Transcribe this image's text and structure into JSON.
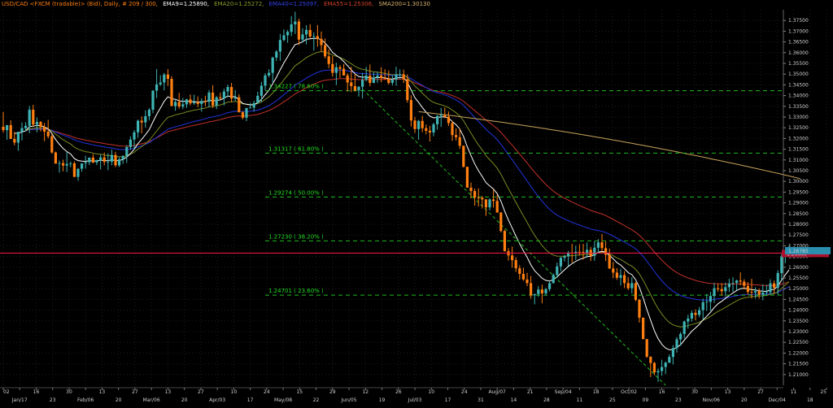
{
  "header": {
    "symbol": "USD/CAD <FXCM (tradable)> (Bid), Daily, # 209 / 300,",
    "ema9": "EMA9=1.25890,",
    "ema20": "EMA20=1.25272,",
    "ema40": "EMA40=1.25097,",
    "ema55": "EMA55=1.25306,",
    "sma200": "SMA200=1.30130"
  },
  "colors": {
    "background": "#000000",
    "bull": "#3fb3b3",
    "bear": "#ff7f11",
    "ema9": "#ffffff",
    "ema20": "#7a8a22",
    "ema40": "#2233dd",
    "ema55": "#c2312a",
    "sma200": "#c8a35c",
    "fib": "#22bb22",
    "price_line": "#ff1a4a",
    "grid": "#1e1e1e"
  },
  "chart_data": {
    "type": "candlestick",
    "y_range": [
      1.205,
      1.38
    ],
    "y_ticks": [
      "1.37500",
      "1.37000",
      "1.36500",
      "1.36000",
      "1.35500",
      "1.35000",
      "1.34500",
      "1.34000",
      "1.33500",
      "1.33000",
      "1.32500",
      "1.32000",
      "1.31500",
      "1.31000",
      "1.30500",
      "1.30000",
      "1.29500",
      "1.29000",
      "1.28500",
      "1.28000",
      "1.27500",
      "1.27000",
      "1.26500",
      "1.26000",
      "1.25500",
      "1.25000",
      "1.24500",
      "1.24000",
      "1.23500",
      "1.23000",
      "1.22500",
      "1.22000",
      "1.21500",
      "1.21000"
    ],
    "x_labels": [
      "02",
      "Jan/17",
      "16",
      "23",
      "30",
      "Feb/06",
      "13",
      "20",
      "27",
      "Mar/06",
      "13",
      "20",
      "27",
      "Apr/03",
      "10",
      "17",
      "24",
      "May/08",
      "15",
      "22",
      "29",
      "Jun/05",
      "12",
      "19",
      "26",
      "Jul/03",
      "10",
      "17",
      "24",
      "31",
      "Aug/07",
      "14",
      "21",
      "28",
      "Sep/04",
      "11",
      "18",
      "25",
      "Oct/02",
      "09",
      "16",
      "23",
      "30",
      "Nov/06",
      "13",
      "20",
      "27",
      "Dec/04",
      "11",
      "18",
      "25"
    ],
    "current_price": {
      "value": 1.2666,
      "label": "1.26660"
    },
    "last_close_label": "1.26785",
    "grid": true,
    "fib_levels": [
      {
        "value": 1.34227,
        "label": "1.34227 ( 78.60% )"
      },
      {
        "value": 1.31317,
        "label": "1.31317 ( 61.80% )"
      },
      {
        "value": 1.29274,
        "label": "1.29274 ( 50.00% )"
      },
      {
        "value": 1.2723,
        "label": "1.27230 ( 38.20% )"
      },
      {
        "value": 1.24701,
        "label": "1.24701 ( 23.60% )"
      }
    ],
    "trendline": {
      "from": {
        "bar": 96,
        "price": 1.343
      },
      "to": {
        "bar": 177,
        "price": 1.205
      }
    },
    "sma200_anchor": {
      "bar": 111,
      "price": 1.3325
    },
    "sma200_end": {
      "bar": 213,
      "price": 1.3013
    },
    "ohlc": [
      [
        1.3255,
        1.3323,
        1.3227,
        1.3239
      ],
      [
        1.3239,
        1.3263,
        1.3194,
        1.3262
      ],
      [
        1.3262,
        1.3285,
        1.3198,
        1.3198
      ],
      [
        1.3198,
        1.3231,
        1.3168,
        1.3181
      ],
      [
        1.3181,
        1.3231,
        1.3143,
        1.3231
      ],
      [
        1.3231,
        1.3275,
        1.3191,
        1.3248
      ],
      [
        1.3248,
        1.3276,
        1.3235,
        1.3259
      ],
      [
        1.3259,
        1.3352,
        1.3224,
        1.3334
      ],
      [
        1.3334,
        1.3357,
        1.3255,
        1.3265
      ],
      [
        1.3265,
        1.3298,
        1.3229,
        1.3277
      ],
      [
        1.3277,
        1.3281,
        1.3233,
        1.3254
      ],
      [
        1.3254,
        1.3272,
        1.3187,
        1.3232
      ],
      [
        1.3232,
        1.3287,
        1.32,
        1.321
      ],
      [
        1.321,
        1.3222,
        1.3129,
        1.3135
      ],
      [
        1.3135,
        1.3139,
        1.3083,
        1.3083
      ],
      [
        1.3083,
        1.3097,
        1.3041,
        1.3085
      ],
      [
        1.3085,
        1.3101,
        1.3047,
        1.3074
      ],
      [
        1.3074,
        1.3137,
        1.3044,
        1.3081
      ],
      [
        1.3081,
        1.3093,
        1.3066,
        1.3084
      ],
      [
        1.3084,
        1.3093,
        1.3021,
        1.3021
      ],
      [
        1.3021,
        1.3061,
        1.3003,
        1.3059
      ],
      [
        1.3059,
        1.3084,
        1.3045,
        1.3084
      ],
      [
        1.3084,
        1.312,
        1.306,
        1.3089
      ],
      [
        1.3089,
        1.3111,
        1.3076,
        1.3111
      ],
      [
        1.3111,
        1.3127,
        1.3085,
        1.3088
      ],
      [
        1.3088,
        1.3102,
        1.3076,
        1.3098
      ],
      [
        1.3098,
        1.3125,
        1.3056,
        1.3112
      ],
      [
        1.3112,
        1.3135,
        1.3075,
        1.3091
      ],
      [
        1.3091,
        1.3131,
        1.3053,
        1.3092
      ],
      [
        1.3092,
        1.3148,
        1.3075,
        1.3123
      ],
      [
        1.3123,
        1.3138,
        1.3067,
        1.3075
      ],
      [
        1.3075,
        1.3112,
        1.3067,
        1.3103
      ],
      [
        1.3103,
        1.3121,
        1.3082,
        1.3119
      ],
      [
        1.3119,
        1.3169,
        1.3086,
        1.316
      ],
      [
        1.316,
        1.321,
        1.3147,
        1.3195
      ],
      [
        1.3195,
        1.3239,
        1.315,
        1.3229
      ],
      [
        1.3229,
        1.3288,
        1.3204,
        1.3283
      ],
      [
        1.3283,
        1.3303,
        1.3224,
        1.3275
      ],
      [
        1.3275,
        1.3331,
        1.3251,
        1.3304
      ],
      [
        1.3304,
        1.3342,
        1.3284,
        1.3334
      ],
      [
        1.3334,
        1.3425,
        1.3318,
        1.3423
      ],
      [
        1.3423,
        1.3524,
        1.3389,
        1.3452
      ],
      [
        1.3452,
        1.3495,
        1.3445,
        1.3461
      ],
      [
        1.3461,
        1.3505,
        1.3424,
        1.3498
      ],
      [
        1.3498,
        1.3523,
        1.3445,
        1.3478
      ],
      [
        1.3478,
        1.3491,
        1.3351,
        1.3351
      ],
      [
        1.3351,
        1.3383,
        1.3329,
        1.337
      ],
      [
        1.337,
        1.3413,
        1.3339,
        1.3349
      ],
      [
        1.3349,
        1.3389,
        1.3337,
        1.3359
      ],
      [
        1.3359,
        1.3385,
        1.3343,
        1.3382
      ],
      [
        1.3382,
        1.3405,
        1.3355,
        1.3364
      ],
      [
        1.3364,
        1.3404,
        1.3357,
        1.337
      ],
      [
        1.337,
        1.3396,
        1.3346,
        1.3361
      ],
      [
        1.3361,
        1.3387,
        1.3325,
        1.3375
      ],
      [
        1.3375,
        1.3399,
        1.3351,
        1.3371
      ],
      [
        1.3371,
        1.3426,
        1.3345,
        1.3414
      ],
      [
        1.3414,
        1.3448,
        1.3342,
        1.3354
      ],
      [
        1.3354,
        1.3398,
        1.3337,
        1.3392
      ],
      [
        1.3392,
        1.3414,
        1.3383,
        1.3387
      ],
      [
        1.3387,
        1.3432,
        1.3354,
        1.3419
      ],
      [
        1.3419,
        1.3451,
        1.3392,
        1.344
      ],
      [
        1.344,
        1.3459,
        1.3369,
        1.3386
      ],
      [
        1.3386,
        1.3426,
        1.3374,
        1.3392
      ],
      [
        1.3392,
        1.3406,
        1.3322,
        1.3322
      ],
      [
        1.3322,
        1.3328,
        1.3289,
        1.3297
      ],
      [
        1.3297,
        1.3342,
        1.3281,
        1.3342
      ],
      [
        1.3342,
        1.3366,
        1.334,
        1.3344
      ],
      [
        1.3344,
        1.3376,
        1.3326,
        1.3365
      ],
      [
        1.3365,
        1.3418,
        1.3364,
        1.3399
      ],
      [
        1.3399,
        1.3464,
        1.3368,
        1.3446
      ],
      [
        1.3446,
        1.3504,
        1.3426,
        1.3494
      ],
      [
        1.3494,
        1.3523,
        1.3485,
        1.3506
      ],
      [
        1.3506,
        1.3581,
        1.3462,
        1.3577
      ],
      [
        1.3577,
        1.3612,
        1.3561,
        1.3605
      ],
      [
        1.3605,
        1.3687,
        1.3562,
        1.3659
      ],
      [
        1.3659,
        1.3708,
        1.3653,
        1.3681
      ],
      [
        1.3681,
        1.3706,
        1.3646,
        1.3697
      ],
      [
        1.3697,
        1.377,
        1.3677,
        1.3732
      ],
      [
        1.3732,
        1.3791,
        1.3687,
        1.3745
      ],
      [
        1.3745,
        1.3758,
        1.3636,
        1.3661
      ],
      [
        1.3661,
        1.3714,
        1.3647,
        1.3685
      ],
      [
        1.3685,
        1.3728,
        1.3638,
        1.3706
      ],
      [
        1.3706,
        1.3733,
        1.3668,
        1.3675
      ],
      [
        1.3675,
        1.3694,
        1.3609,
        1.3677
      ],
      [
        1.3677,
        1.3729,
        1.3628,
        1.3664
      ],
      [
        1.3664,
        1.3698,
        1.3604,
        1.3635
      ],
      [
        1.3635,
        1.3666,
        1.3573,
        1.3583
      ],
      [
        1.3583,
        1.3615,
        1.3528,
        1.3547
      ],
      [
        1.3547,
        1.3584,
        1.3488,
        1.3506
      ],
      [
        1.3506,
        1.3553,
        1.3449,
        1.3532
      ],
      [
        1.3532,
        1.3542,
        1.3483,
        1.3525
      ],
      [
        1.3525,
        1.3547,
        1.3493,
        1.3494
      ],
      [
        1.3494,
        1.3504,
        1.3419,
        1.3461
      ],
      [
        1.3461,
        1.3534,
        1.3416,
        1.3444
      ],
      [
        1.3444,
        1.3501,
        1.3419,
        1.3424
      ],
      [
        1.3424,
        1.3444,
        1.3395,
        1.3441
      ],
      [
        1.3441,
        1.3506,
        1.3386,
        1.3473
      ],
      [
        1.3473,
        1.3534,
        1.3467,
        1.3493
      ],
      [
        1.3493,
        1.3545,
        1.3443,
        1.3459
      ],
      [
        1.3459,
        1.3509,
        1.3458,
        1.3484
      ],
      [
        1.3484,
        1.3511,
        1.3459,
        1.3493
      ],
      [
        1.3493,
        1.3532,
        1.3462,
        1.3482
      ],
      [
        1.3482,
        1.3523,
        1.3475,
        1.3478
      ],
      [
        1.3478,
        1.3517,
        1.3451,
        1.3459
      ],
      [
        1.3459,
        1.3493,
        1.3447,
        1.3474
      ],
      [
        1.3474,
        1.3535,
        1.3446,
        1.3499
      ],
      [
        1.3499,
        1.3522,
        1.3476,
        1.3499
      ],
      [
        1.3499,
        1.3521,
        1.3459,
        1.3476
      ],
      [
        1.3476,
        1.3499,
        1.3367,
        1.3379
      ],
      [
        1.3379,
        1.3401,
        1.3256,
        1.3284
      ],
      [
        1.3284,
        1.3301,
        1.3226,
        1.3244
      ],
      [
        1.3244,
        1.3287,
        1.3194,
        1.3282
      ],
      [
        1.3282,
        1.3305,
        1.3229,
        1.3248
      ],
      [
        1.3248,
        1.3265,
        1.3219,
        1.3236
      ],
      [
        1.3236,
        1.3259,
        1.3186,
        1.3228
      ],
      [
        1.3228,
        1.3274,
        1.321,
        1.3266
      ],
      [
        1.3266,
        1.3309,
        1.3241,
        1.3305
      ],
      [
        1.3305,
        1.3343,
        1.3254,
        1.331
      ],
      [
        1.331,
        1.3345,
        1.3295,
        1.3302
      ],
      [
        1.3302,
        1.3326,
        1.3258,
        1.3272
      ],
      [
        1.3272,
        1.3282,
        1.3189,
        1.3216
      ],
      [
        1.3216,
        1.3247,
        1.3191,
        1.3206
      ],
      [
        1.3206,
        1.3247,
        1.3152,
        1.3166
      ],
      [
        1.3166,
        1.3167,
        1.3065,
        1.3068
      ],
      [
        1.3068,
        1.3069,
        1.297,
        1.2971
      ],
      [
        1.2971,
        1.2995,
        1.2921,
        1.2955
      ],
      [
        1.2955,
        1.2966,
        1.2887,
        1.2925
      ],
      [
        1.2925,
        1.2968,
        1.2883,
        1.2924
      ],
      [
        1.2924,
        1.2932,
        1.2874,
        1.2916
      ],
      [
        1.2916,
        1.2918,
        1.2839,
        1.2879
      ],
      [
        1.2879,
        1.2921,
        1.2865,
        1.2916
      ],
      [
        1.2916,
        1.2961,
        1.2878,
        1.2909
      ],
      [
        1.2909,
        1.2937,
        1.2854,
        1.2855
      ],
      [
        1.2855,
        1.2857,
        1.2762,
        1.2769
      ],
      [
        1.2769,
        1.2775,
        1.2673,
        1.2675
      ],
      [
        1.2675,
        1.2689,
        1.2631,
        1.2655
      ],
      [
        1.2655,
        1.2696,
        1.2598,
        1.2633
      ],
      [
        1.2633,
        1.2646,
        1.2578,
        1.2595
      ],
      [
        1.2595,
        1.2609,
        1.2542,
        1.2569
      ],
      [
        1.2569,
        1.2598,
        1.2537,
        1.2543
      ],
      [
        1.2543,
        1.2574,
        1.2511,
        1.2526
      ],
      [
        1.2526,
        1.2559,
        1.2454,
        1.2469
      ],
      [
        1.2469,
        1.2476,
        1.2427,
        1.2475
      ],
      [
        1.2475,
        1.2512,
        1.2462,
        1.2496
      ],
      [
        1.2496,
        1.2519,
        1.2432,
        1.2478
      ],
      [
        1.2478,
        1.2504,
        1.2468,
        1.2498
      ],
      [
        1.2498,
        1.2536,
        1.2487,
        1.2526
      ],
      [
        1.2526,
        1.2571,
        1.2524,
        1.2564
      ],
      [
        1.2564,
        1.2622,
        1.2551,
        1.2604
      ],
      [
        1.2604,
        1.2648,
        1.2581,
        1.2644
      ],
      [
        1.2644,
        1.2658,
        1.2627,
        1.2651
      ],
      [
        1.2651,
        1.2676,
        1.2605,
        1.2668
      ],
      [
        1.2668,
        1.2709,
        1.2622,
        1.2667
      ],
      [
        1.2667,
        1.2701,
        1.2634,
        1.2672
      ],
      [
        1.2672,
        1.2707,
        1.2655,
        1.2671
      ],
      [
        1.2671,
        1.2709,
        1.2636,
        1.2667
      ],
      [
        1.2667,
        1.2715,
        1.2644,
        1.2681
      ],
      [
        1.2681,
        1.2695,
        1.2629,
        1.2653
      ],
      [
        1.2653,
        1.2722,
        1.263,
        1.2691
      ],
      [
        1.2691,
        1.2731,
        1.2666,
        1.2716
      ],
      [
        1.2716,
        1.2755,
        1.2675,
        1.2689
      ],
      [
        1.2689,
        1.272,
        1.2629,
        1.2658
      ],
      [
        1.2658,
        1.2687,
        1.2593,
        1.2594
      ],
      [
        1.2594,
        1.2625,
        1.2549,
        1.2575
      ],
      [
        1.2575,
        1.2596,
        1.2541,
        1.2551
      ],
      [
        1.2551,
        1.2593,
        1.2515,
        1.2563
      ],
      [
        1.2563,
        1.2582,
        1.2503,
        1.2526
      ],
      [
        1.2526,
        1.2554,
        1.2494,
        1.2502
      ],
      [
        1.2502,
        1.2553,
        1.2478,
        1.2526
      ],
      [
        1.2526,
        1.2532,
        1.2441,
        1.2448
      ],
      [
        1.2448,
        1.2452,
        1.2342,
        1.2365
      ],
      [
        1.2365,
        1.2365,
        1.2264,
        1.2265
      ],
      [
        1.2265,
        1.2266,
        1.2178,
        1.2183
      ],
      [
        1.2183,
        1.2185,
        1.2088,
        1.2154
      ],
      [
        1.2154,
        1.2159,
        1.2097,
        1.211
      ],
      [
        1.211,
        1.2128,
        1.2065,
        1.2116
      ],
      [
        1.2116,
        1.2169,
        1.2094,
        1.2135
      ],
      [
        1.2135,
        1.2161,
        1.2102,
        1.2155
      ],
      [
        1.2155,
        1.2194,
        1.2154,
        1.2182
      ],
      [
        1.2182,
        1.2237,
        1.2147,
        1.2223
      ],
      [
        1.2223,
        1.2275,
        1.2202,
        1.2264
      ],
      [
        1.2264,
        1.2297,
        1.2234,
        1.2289
      ],
      [
        1.2289,
        1.2351,
        1.2268,
        1.2347
      ],
      [
        1.2347,
        1.2379,
        1.2314,
        1.2361
      ],
      [
        1.2361,
        1.2399,
        1.2346,
        1.2387
      ],
      [
        1.2387,
        1.2403,
        1.2352,
        1.2378
      ],
      [
        1.2378,
        1.2415,
        1.2367,
        1.24
      ],
      [
        1.24,
        1.2454,
        1.2356,
        1.2437
      ],
      [
        1.2437,
        1.2475,
        1.2397,
        1.2439
      ],
      [
        1.2439,
        1.2485,
        1.2397,
        1.2466
      ],
      [
        1.2466,
        1.2527,
        1.2434,
        1.2502
      ],
      [
        1.2502,
        1.2524,
        1.2486,
        1.2498
      ],
      [
        1.2498,
        1.2526,
        1.2468,
        1.2488
      ],
      [
        1.2488,
        1.2529,
        1.2462,
        1.2507
      ],
      [
        1.2507,
        1.2546,
        1.2485,
        1.2524
      ],
      [
        1.2524,
        1.2554,
        1.2484,
        1.2527
      ],
      [
        1.2527,
        1.2542,
        1.2493,
        1.2538
      ],
      [
        1.2538,
        1.2576,
        1.2516,
        1.2533
      ],
      [
        1.2533,
        1.2544,
        1.2496,
        1.2513
      ],
      [
        1.2513,
        1.2531,
        1.2472,
        1.2485
      ],
      [
        1.2485,
        1.2546,
        1.2455,
        1.2482
      ],
      [
        1.2482,
        1.2506,
        1.2454,
        1.2489
      ],
      [
        1.2489,
        1.2501,
        1.2454,
        1.2472
      ],
      [
        1.2472,
        1.252,
        1.2446,
        1.2482
      ],
      [
        1.2482,
        1.2518,
        1.2469,
        1.2484
      ],
      [
        1.2484,
        1.2544,
        1.2473,
        1.2525
      ],
      [
        1.2525,
        1.2538,
        1.2476,
        1.2504
      ],
      [
        1.2504,
        1.2586,
        1.2472,
        1.2573
      ],
      [
        1.2573,
        1.2661,
        1.2539,
        1.2651
      ],
      [
        1.2651,
        1.2677,
        1.2619,
        1.2664
      ],
      [
        1.2664,
        1.2702,
        1.2653,
        1.2679
      ]
    ]
  }
}
